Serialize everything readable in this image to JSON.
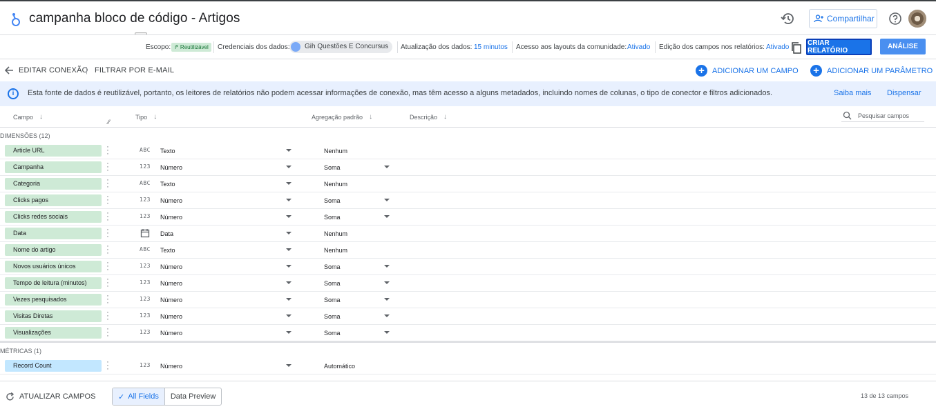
{
  "header": {
    "title": "campanha bloco de código - Artigos",
    "share_label": "Compartilhar"
  },
  "info_bar": {
    "scope_label": "Escopo:",
    "scope_chip": "↱ Reutilizável",
    "credentials_label": "Credenciais dos dados:",
    "credentials_user": "Gih Questões E Concursus",
    "refresh_label": "Atualização dos dados:",
    "refresh_value": "15 minutos",
    "community_label": "Acesso aos layouts da comunidade:",
    "community_value": "Ativado",
    "edit_fields_label": "Edição dos campos nos relatórios:",
    "edit_fields_value": "Ativado",
    "create_report": "CRIAR RELATÓRIO",
    "analysis": "ANÁLISE"
  },
  "actions": {
    "edit_connection": "EDITAR CONEXÃO",
    "filter_email": "FILTRAR POR E-MAIL",
    "add_field": "ADICIONAR UM CAMPO",
    "add_param": "ADICIONAR UM PARÂMETRO"
  },
  "banner": {
    "message": "Esta fonte de dados é reutilizável, portanto, os leitores de relatórios não podem acessar informações de conexão, mas têm acesso a alguns metadados, incluindo nomes de colunas, o tipo de conector e filtros adicionados.",
    "learn_more": "Saiba mais",
    "dismiss": "Dispensar"
  },
  "table": {
    "col_field": "Campo",
    "col_type": "Tipo",
    "col_agg": "Agregação padrão",
    "col_desc": "Descrição",
    "search_placeholder": "Pesquisar campos",
    "dimensions_label": "DIMENSÕES (12)",
    "metrics_label": "MÉTRICAS (1)",
    "dimensions": [
      {
        "name": "Article URL",
        "type_icon": "ABC",
        "type": "Texto",
        "agg": "Nenhum",
        "agg_dd": false
      },
      {
        "name": "Campanha",
        "type_icon": "123",
        "type": "Número",
        "agg": "Soma",
        "agg_dd": true
      },
      {
        "name": "Categoria",
        "type_icon": "ABC",
        "type": "Texto",
        "agg": "Nenhum",
        "agg_dd": false
      },
      {
        "name": "Clicks pagos",
        "type_icon": "123",
        "type": "Número",
        "agg": "Soma",
        "agg_dd": true
      },
      {
        "name": "Clicks redes sociais",
        "type_icon": "123",
        "type": "Número",
        "agg": "Soma",
        "agg_dd": true
      },
      {
        "name": "Data",
        "type_icon": "calendar",
        "type": "Data",
        "agg": "Nenhum",
        "agg_dd": false
      },
      {
        "name": "Nome do artigo",
        "type_icon": "ABC",
        "type": "Texto",
        "agg": "Nenhum",
        "agg_dd": false
      },
      {
        "name": "Novos usuários únicos",
        "type_icon": "123",
        "type": "Número",
        "agg": "Soma",
        "agg_dd": true
      },
      {
        "name": "Tempo de leitura (minutos)",
        "type_icon": "123",
        "type": "Número",
        "agg": "Soma",
        "agg_dd": true
      },
      {
        "name": "Vezes pesquisados",
        "type_icon": "123",
        "type": "Número",
        "agg": "Soma",
        "agg_dd": true
      },
      {
        "name": "Visitas Diretas",
        "type_icon": "123",
        "type": "Número",
        "agg": "Soma",
        "agg_dd": true
      },
      {
        "name": "Visualizações",
        "type_icon": "123",
        "type": "Número",
        "agg": "Soma",
        "agg_dd": true
      }
    ],
    "metrics": [
      {
        "name": "Record Count",
        "type_icon": "123",
        "type": "Número",
        "agg": "Automático",
        "agg_dd": false
      }
    ]
  },
  "footer": {
    "refresh_fields": "ATUALIZAR CAMPOS",
    "all_fields": "All Fields",
    "data_preview": "Data Preview",
    "count": "13 de 13 campos"
  },
  "colors": {
    "accent": "#1a73e8",
    "dimension_pill": "#ceead6",
    "metric_pill": "#c2e7ff",
    "banner_bg": "#e8f0fe"
  }
}
